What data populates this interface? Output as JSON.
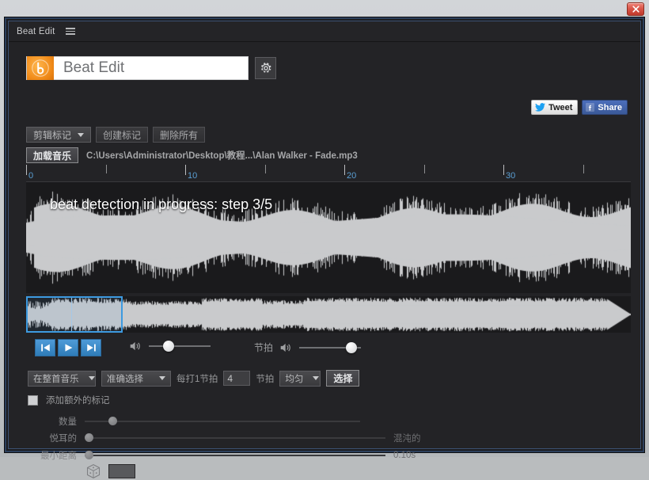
{
  "window": {
    "close_label": "x"
  },
  "menubar": {
    "title": "Beat Edit",
    "menu_icon": "hamburger-icon"
  },
  "brand": {
    "logo_letter": "b",
    "title": "Beat Edit",
    "settings_icon": "gear-icon"
  },
  "social": {
    "tweet_label": "Tweet",
    "share_label": "Share"
  },
  "toolbar": {
    "marker_mode": "剪辑标记",
    "create_markers": "创建标记",
    "delete_all": "删除所有",
    "load_music": "加载音乐",
    "file_path": "C:\\Users\\Administrator\\Desktop\\教程...\\Alan Walker - Fade.mp3"
  },
  "ruler": {
    "labels": [
      "0",
      "10",
      "20",
      "30"
    ],
    "label_color": "#5a9fd4"
  },
  "waveform": {
    "status": "beat detection in progress: step 3/5",
    "selection_start_pct": 0,
    "selection_width_pct": 16
  },
  "transport": {
    "prev_icon": "skip-back-icon",
    "play_icon": "play-icon",
    "next_icon": "skip-forward-icon",
    "volume_icon": "speaker-icon",
    "volume_value": 28,
    "tempo_label": "节拍",
    "tempo_icon": "speaker-icon",
    "tempo_value": 92
  },
  "options": {
    "scope": "在整首音乐",
    "precision": "准确选择",
    "every_label": "每打1节拍",
    "beats_value": "4",
    "beats_label": "节拍",
    "distribution": "均匀",
    "select_button": "选择"
  },
  "extra": {
    "checkbox_label": "添加额外的标记",
    "checked": false
  },
  "sliders": {
    "amount": {
      "label": "数量",
      "value": 9,
      "right": ""
    },
    "pleasant": {
      "label": "悦耳的",
      "value": 0,
      "right": "混沌的"
    },
    "min_distance": {
      "label": "最小距离",
      "value": 0,
      "right": "0.10s"
    }
  },
  "bottom": {
    "dice_icon": "dice-icon",
    "color_swatch": "#58595c"
  },
  "colors": {
    "accent_blue": "#3d9ae0",
    "brand_orange": "#f08a18",
    "panel_bg": "#232326",
    "wave_bg": "#1a1a1c",
    "wave_fg": "#c9cacc"
  }
}
